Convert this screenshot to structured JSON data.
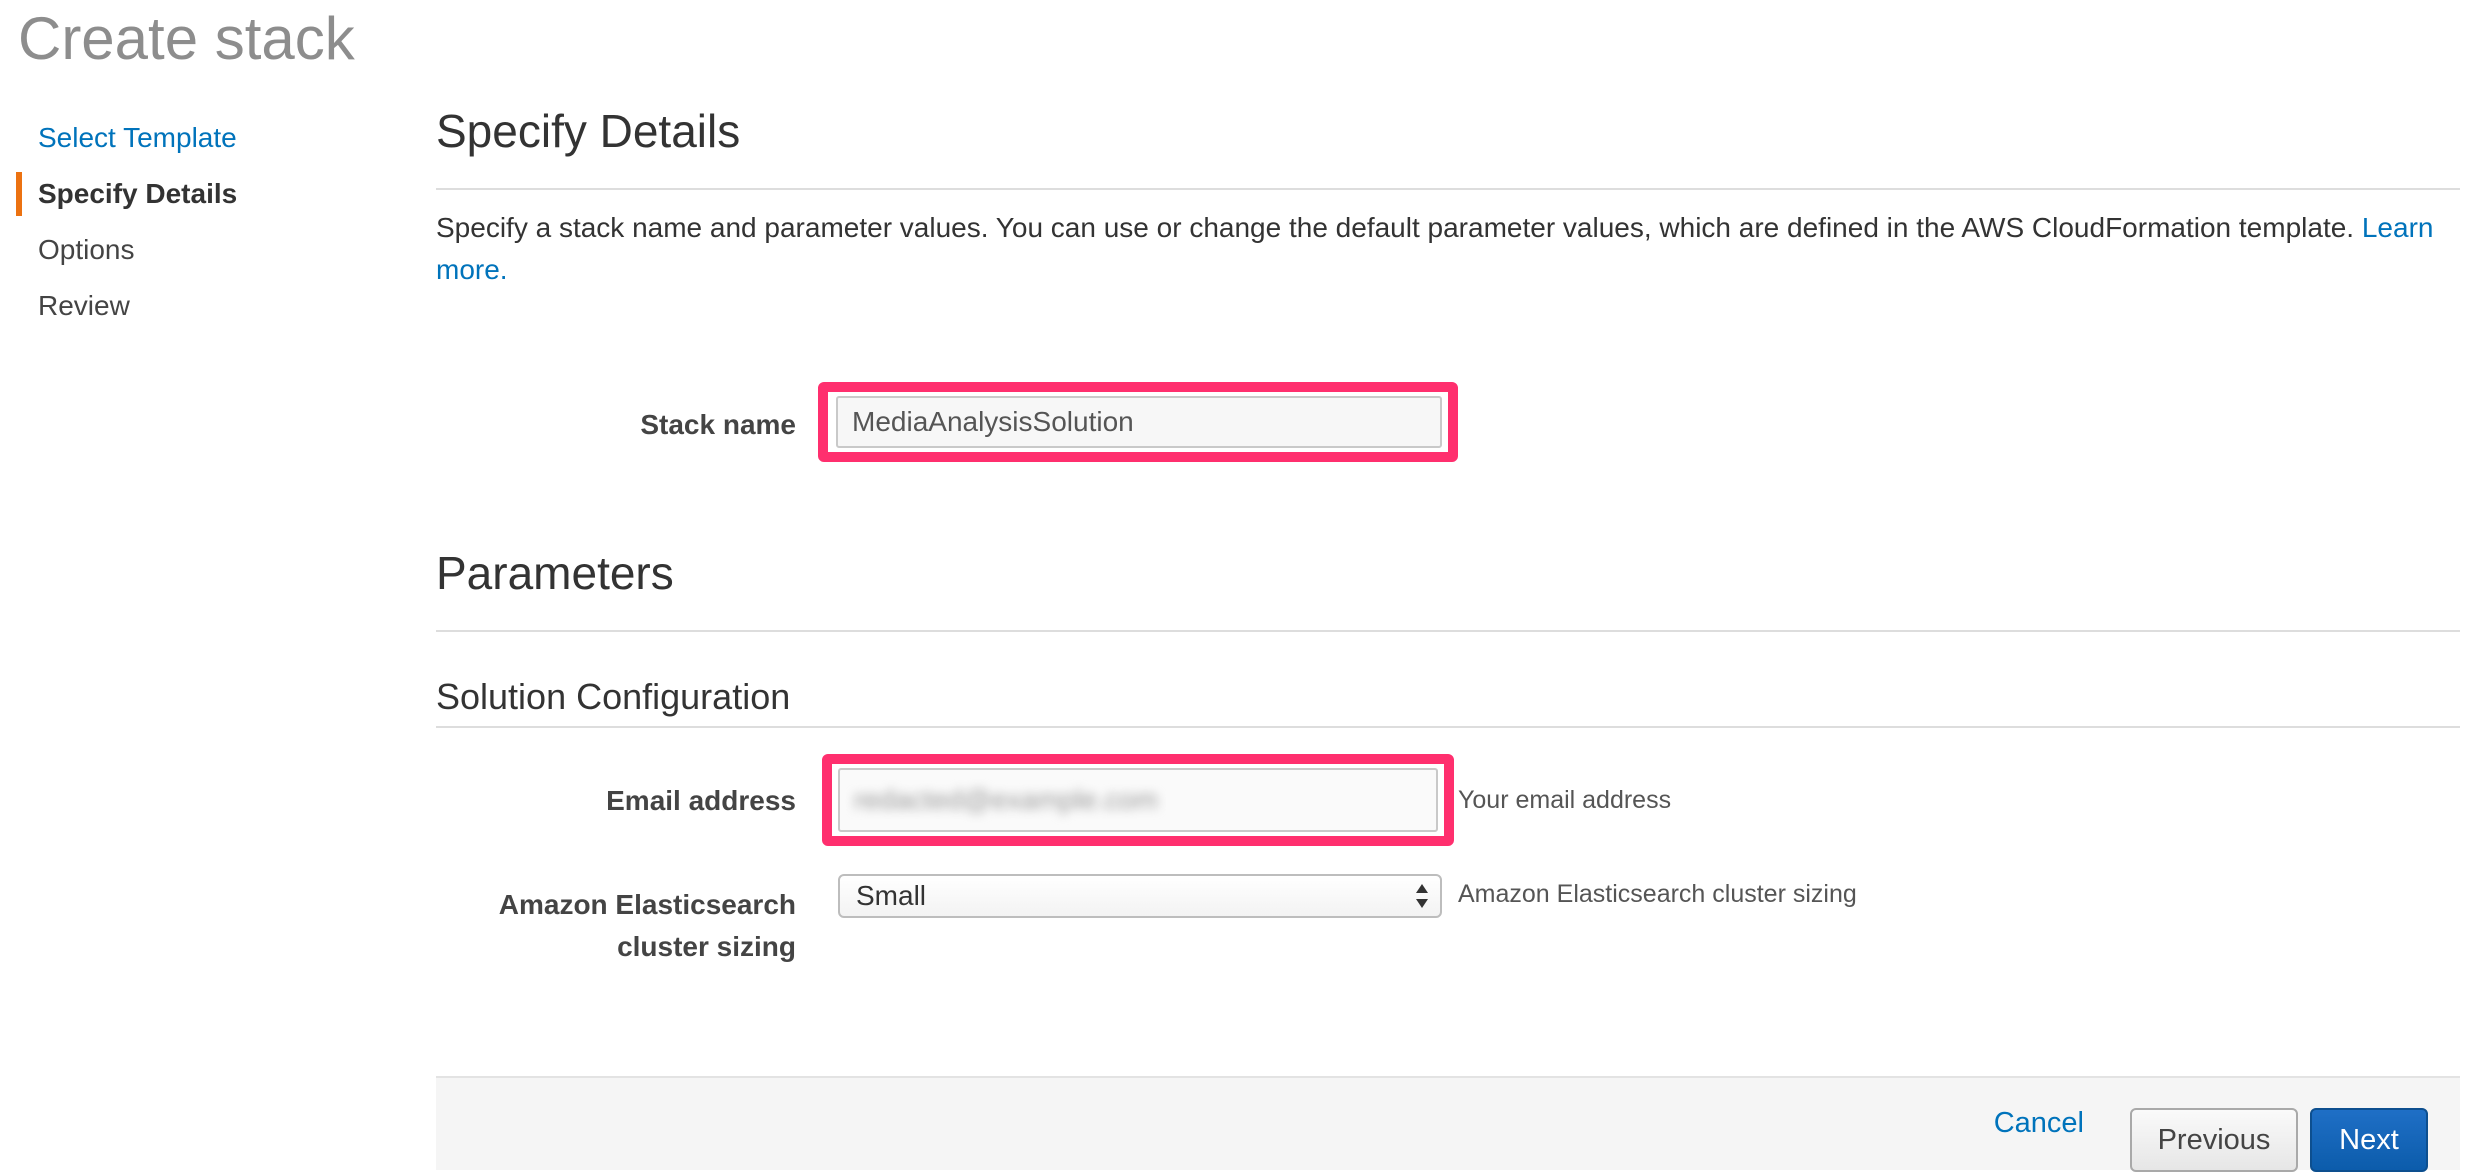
{
  "page": {
    "title": "Create stack"
  },
  "sidebar": {
    "steps": [
      {
        "label": "Select Template",
        "state": "completed-link"
      },
      {
        "label": "Specify Details",
        "state": "active"
      },
      {
        "label": "Options",
        "state": "pending"
      },
      {
        "label": "Review",
        "state": "pending"
      }
    ]
  },
  "details": {
    "heading": "Specify Details",
    "description": "Specify a stack name and parameter values. You can use or change the default parameter values, which are defined in the AWS CloudFormation template.",
    "learn_more": "Learn more.",
    "stack_name_label": "Stack name",
    "stack_name_value": "MediaAnalysisSolution"
  },
  "parameters": {
    "heading": "Parameters",
    "group_heading": "Solution Configuration",
    "email_label": "Email address",
    "email_value": "redacted@example.com",
    "email_hint": "Your email address",
    "es_label_line1": "Amazon Elasticsearch",
    "es_label_line2": "cluster sizing",
    "es_selected": "Small",
    "es_hint": "Amazon Elasticsearch cluster sizing"
  },
  "footer": {
    "cancel": "Cancel",
    "previous": "Previous",
    "next": "Next"
  },
  "colors": {
    "highlight": "#ff2f6e",
    "link": "#0073bb",
    "active_step_marker": "#ec7211",
    "primary_button": "#0c5cab"
  },
  "icons": {
    "select_arrows": "up-down-arrows-icon"
  }
}
